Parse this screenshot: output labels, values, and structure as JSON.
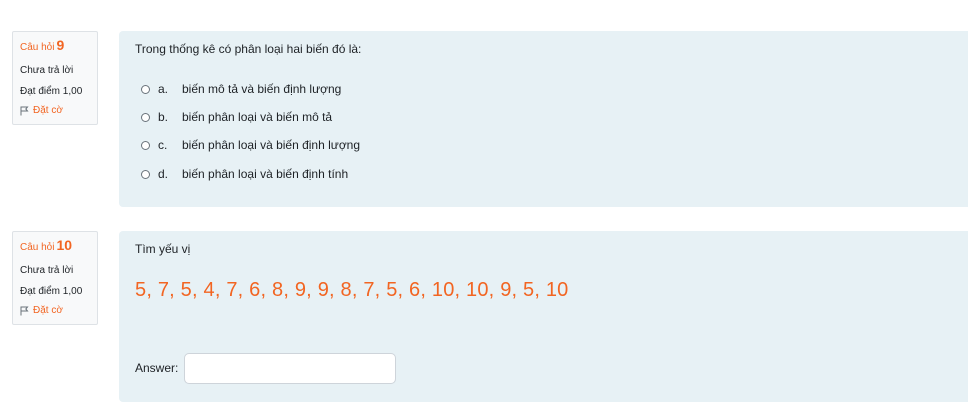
{
  "questions": [
    {
      "label": "Câu hỏi",
      "number": "9",
      "state": "Chưa trả lời",
      "grade": "Đạt điểm 1,00",
      "flag_label": "Đặt cờ",
      "text": "Trong thống kê có phân loại hai biến đó là:",
      "options": [
        {
          "letter": "a.",
          "text": "biến mô tả và biến định lượng"
        },
        {
          "letter": "b.",
          "text": "biến phân loại và biến mô tả"
        },
        {
          "letter": "c.",
          "text": "biến phân loại và biến định lượng"
        },
        {
          "letter": "d.",
          "text": "biến phân loại và biến định tính"
        }
      ]
    },
    {
      "label": "Câu hỏi",
      "number": "10",
      "state": "Chưa trả lời",
      "grade": "Đạt điểm 1,00",
      "flag_label": "Đặt cờ",
      "text": "Tìm yếu vị",
      "data_values": "5, 7, 5, 4, 7, 6, 8, 9, 9, 8, 7, 5, 6, 10, 10, 9, 5, 10",
      "answer_label": "Answer:",
      "answer_value": ""
    }
  ],
  "colors": {
    "accent": "#f26522",
    "content_bg": "#e7f1f5",
    "info_bg": "#f8f9fa"
  },
  "icons": {
    "flag": "flag-icon"
  }
}
